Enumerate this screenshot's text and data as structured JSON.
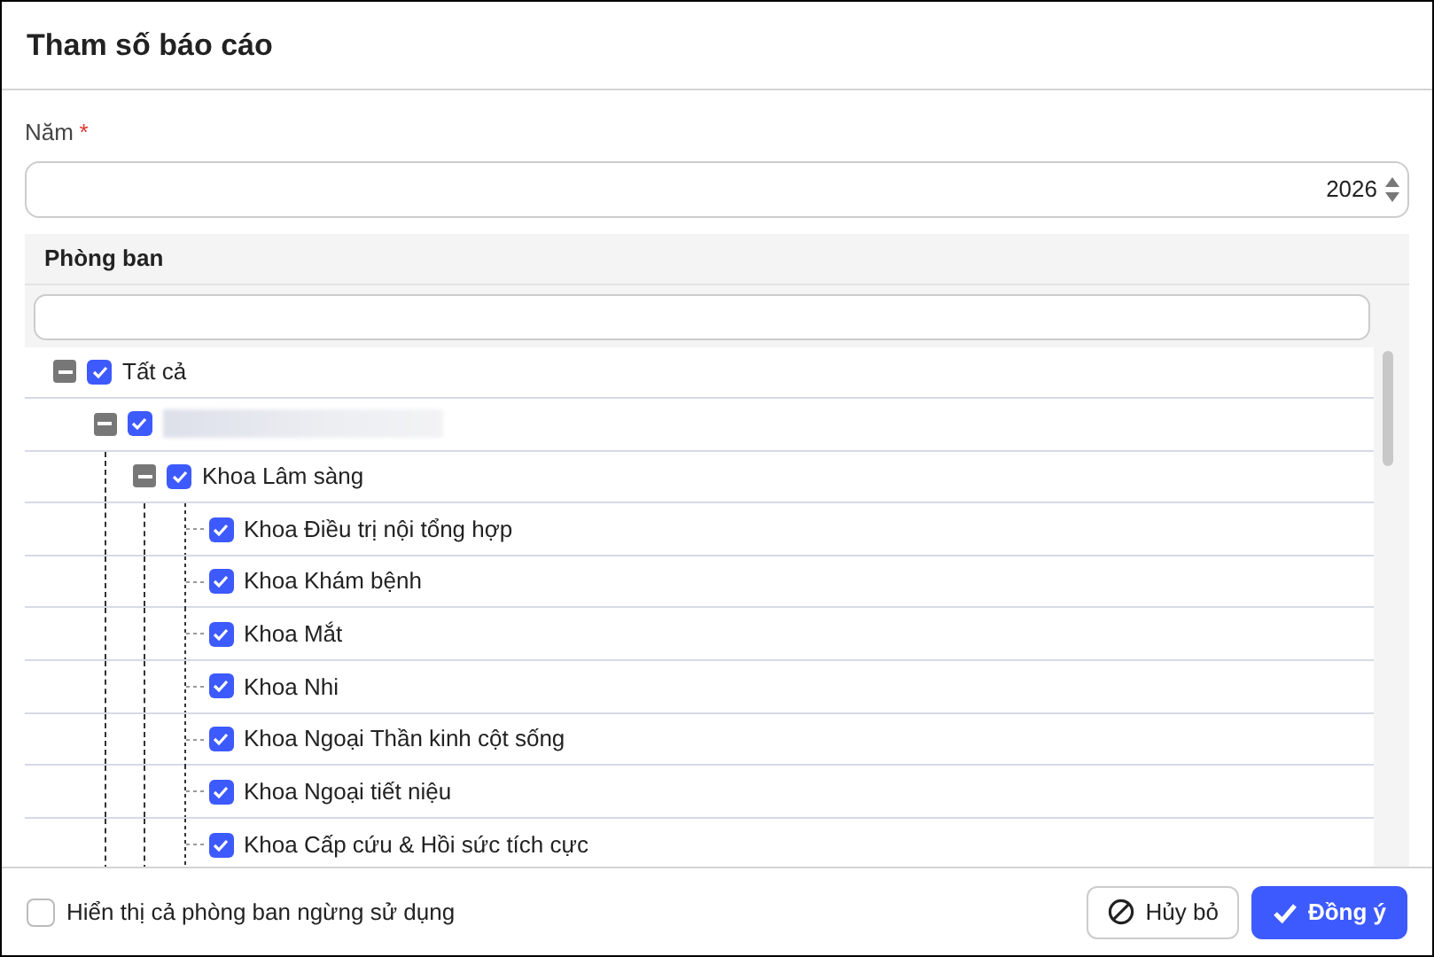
{
  "dialog": {
    "title": "Tham số báo cáo"
  },
  "year_field": {
    "label": "Năm",
    "required_mark": "*",
    "value": "2026"
  },
  "department_panel": {
    "title": "Phòng ban",
    "tree": [
      {
        "label": "Tất cả",
        "checked": true,
        "expanded": true,
        "children": [
          {
            "redacted": true,
            "checked": true,
            "expanded": true,
            "children": [
              {
                "label": "Khoa Lâm sàng",
                "checked": true,
                "expanded": true,
                "children": [
                  {
                    "label": "Khoa Điều trị nội tổng hợp",
                    "checked": true
                  },
                  {
                    "label": "Khoa Khám bệnh",
                    "checked": true
                  },
                  {
                    "label": "Khoa Mắt",
                    "checked": true
                  },
                  {
                    "label": "Khoa Nhi",
                    "checked": true
                  },
                  {
                    "label": "Khoa Ngoại Thần kinh cột sống",
                    "checked": true
                  },
                  {
                    "label": "Khoa Ngoại tiết niệu",
                    "checked": true
                  },
                  {
                    "label": "Khoa Cấp cứu & Hồi sức tích cực",
                    "checked": true
                  }
                ]
              }
            ]
          }
        ]
      }
    ]
  },
  "footer": {
    "show_inactive": {
      "label": "Hiển thị cả phòng ban ngừng sử dụng",
      "checked": false
    },
    "buttons": [
      {
        "kind": "cancel",
        "label": "Hủy bỏ"
      },
      {
        "kind": "confirm",
        "label": "Đồng ý"
      }
    ]
  }
}
